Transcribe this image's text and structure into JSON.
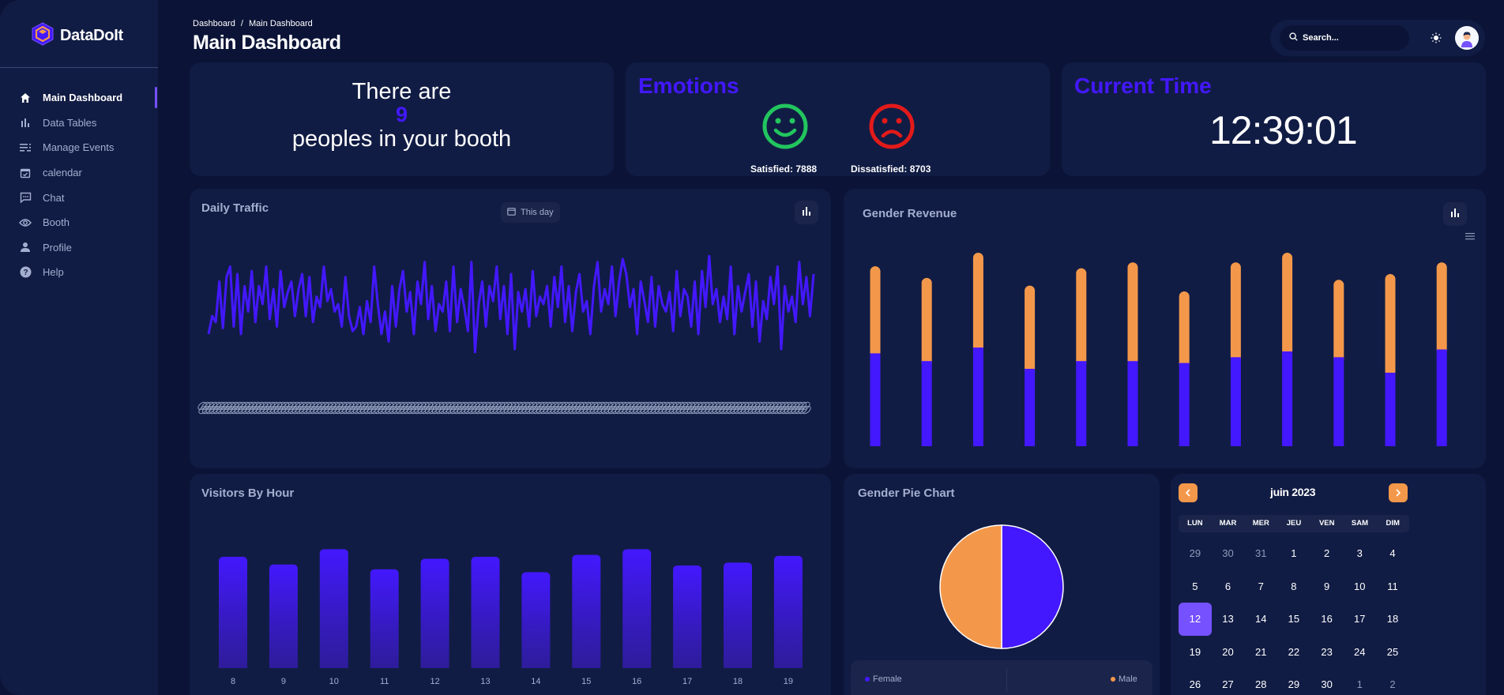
{
  "brand": {
    "name": "DataDoIt"
  },
  "sidebar": {
    "items": [
      {
        "label": "Main Dashboard",
        "icon": "home-icon",
        "active": true
      },
      {
        "label": "Data Tables",
        "icon": "bar-chart-icon"
      },
      {
        "label": "Manage Events",
        "icon": "list-icon"
      },
      {
        "label": "calendar",
        "icon": "calendar-icon"
      },
      {
        "label": "Chat",
        "icon": "chat-icon"
      },
      {
        "label": "Booth",
        "icon": "eye-icon"
      },
      {
        "label": "Profile",
        "icon": "person-icon"
      },
      {
        "label": "Help",
        "icon": "help-icon"
      }
    ]
  },
  "header": {
    "breadcrumb": [
      "Dashboard",
      "/",
      "Main Dashboard"
    ],
    "title": "Main Dashboard",
    "search_placeholder": "Search..."
  },
  "booth": {
    "line1": "There are",
    "count": "9",
    "line2": "peoples in your booth"
  },
  "emotions": {
    "title": "Emotions",
    "satisfied_label": "Satisfied: 7888",
    "dissatisfied_label": "Dissatisfied: 8703",
    "colors": {
      "satisfied": "#22c55e",
      "dissatisfied": "#e31a1a"
    }
  },
  "time": {
    "title": "Current Time",
    "value": "12:39:01"
  },
  "daily_traffic": {
    "title": "Daily Traffic",
    "filter_label": "This day"
  },
  "gender_revenue": {
    "title": "Gender Revenue"
  },
  "visitors_by_hour": {
    "title": "Visitors By Hour"
  },
  "gender_pie": {
    "title": "Gender Pie Chart",
    "female_label": "Female",
    "male_label": "Male"
  },
  "calendar": {
    "month_label": "juin 2023",
    "weekdays": [
      "LUN",
      "MAR",
      "MER",
      "JEU",
      "VEN",
      "SAM",
      "DIM"
    ],
    "weeks": [
      [
        "29",
        "30",
        "31",
        "1",
        "2",
        "3",
        "4"
      ],
      [
        "5",
        "6",
        "7",
        "8",
        "9",
        "10",
        "11"
      ],
      [
        "12",
        "13",
        "14",
        "15",
        "16",
        "17",
        "18"
      ],
      [
        "19",
        "20",
        "21",
        "22",
        "23",
        "24",
        "25"
      ],
      [
        "26",
        "27",
        "28",
        "29",
        "30",
        "1",
        "2"
      ]
    ],
    "selected": "12"
  },
  "colors": {
    "accent": "#4318ff",
    "accent_light": "#7551ff",
    "orange": "#f3984a",
    "card": "#111c44",
    "bg": "#0b1437"
  },
  "chart_data": [
    {
      "type": "line",
      "title": "Daily Traffic",
      "series": [
        {
          "values": [
            40,
            52,
            48,
            75,
            44,
            78,
            85,
            45,
            80,
            40,
            72,
            55,
            82,
            48,
            72,
            60,
            85,
            50,
            70,
            45,
            82,
            58,
            68,
            75,
            52,
            70,
            80,
            52,
            78,
            48,
            65,
            58,
            85,
            62,
            70,
            55,
            60,
            45,
            78,
            52,
            42,
            45,
            58,
            40,
            62,
            48,
            85,
            60,
            40,
            55,
            35,
            72,
            45,
            70,
            82,
            55,
            68,
            40,
            75,
            60,
            88,
            50,
            72,
            42,
            60,
            55,
            75,
            42,
            85,
            48,
            70,
            58,
            42,
            88,
            28,
            60,
            75,
            45,
            72,
            62,
            85,
            50,
            72,
            40,
            80,
            30,
            68,
            55,
            70,
            45,
            82,
            52,
            65,
            60,
            72,
            45,
            78,
            58,
            85,
            48,
            72,
            42,
            68,
            80,
            55,
            62,
            40,
            72,
            88,
            55,
            70,
            60,
            85,
            52,
            75,
            90,
            80,
            58,
            70,
            40,
            75,
            62,
            48,
            78,
            45,
            72,
            60,
            55,
            68,
            42,
            82,
            52,
            70,
            65,
            45,
            75,
            40,
            82,
            58,
            92,
            60,
            70,
            48,
            65,
            50,
            85,
            40,
            72,
            55,
            68,
            80,
            45,
            75,
            35,
            62,
            50,
            78,
            60,
            85,
            30,
            72,
            55,
            65,
            48,
            88,
            60,
            78,
            52,
            80
          ]
        }
      ],
      "ylim": [
        0,
        100
      ]
    },
    {
      "type": "bar",
      "title": "Gender Revenue",
      "stacked": true,
      "series": [
        {
          "color": "#4318ff",
          "values": [
            48,
            44,
            51,
            40,
            44,
            44,
            43,
            46,
            49,
            46,
            38,
            50
          ]
        },
        {
          "color": "#f3984a",
          "values": [
            45,
            43,
            49,
            43,
            48,
            51,
            37,
            49,
            51,
            40,
            51,
            45
          ]
        }
      ],
      "ylim": [
        0,
        110
      ]
    },
    {
      "type": "bar",
      "title": "Visitors By Hour",
      "categories": [
        "8",
        "9",
        "10",
        "11",
        "12",
        "13",
        "14",
        "15",
        "16",
        "17",
        "18",
        "19"
      ],
      "values": [
        116,
        108,
        124,
        103,
        114,
        116,
        100,
        118,
        124,
        107,
        110,
        117
      ],
      "ylim": [
        0,
        150
      ]
    },
    {
      "type": "pie",
      "title": "Gender Pie Chart",
      "labels": [
        "Female",
        "Male"
      ],
      "values": [
        50,
        50
      ],
      "colors": [
        "#4318ff",
        "#f3984a"
      ]
    }
  ]
}
